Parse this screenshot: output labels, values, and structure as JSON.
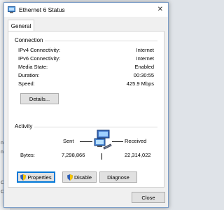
{
  "window": {
    "title": "Ethernet 6 Status",
    "close_glyph": "✕"
  },
  "tabs": [
    {
      "label": "General"
    }
  ],
  "connection": {
    "label": "Connection",
    "rows": [
      {
        "label": "IPv4 Connectivity:",
        "value": "Internet"
      },
      {
        "label": "IPv6 Connectivity:",
        "value": "Internet"
      },
      {
        "label": "Media State:",
        "value": "Enabled"
      },
      {
        "label": "Duration:",
        "value": "00:30:55"
      },
      {
        "label": "Speed:",
        "value": "425.9 Mbps"
      }
    ],
    "details_button": "Details..."
  },
  "activity": {
    "label": "Activity",
    "sent_label": "Sent",
    "received_label": "Received",
    "bytes_label": "Bytes:",
    "bytes_sent": "7,298,866",
    "bytes_received": "22,314,022"
  },
  "buttons": {
    "properties": "Properties",
    "disable": "Disable",
    "diagnose": "Diagnose",
    "close": "Close"
  },
  "background_fragments": [
    "n",
    "n",
    "C",
    "C"
  ],
  "icons": {
    "title": "network-adapter-icon",
    "activity": "network-computers-icon",
    "shield": "uac-shield-icon"
  },
  "colors": {
    "focus": "#0078d7",
    "window_border": "#7a9cc6",
    "button_face": "#e1e1e1"
  }
}
